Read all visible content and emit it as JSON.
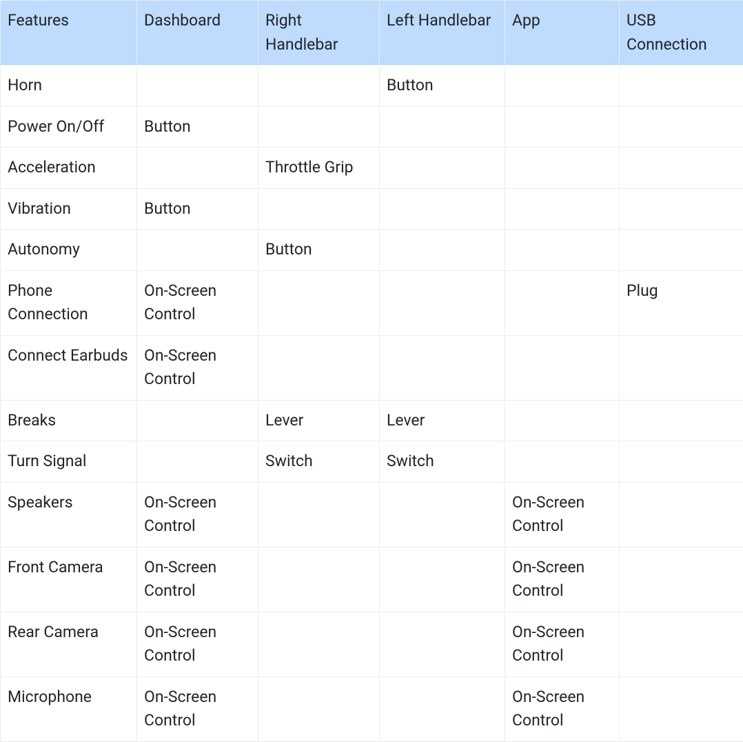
{
  "table": {
    "headers": [
      "Features",
      "Dashboard",
      "Right Handlebar",
      "Left Handlebar",
      "App",
      "USB Connection"
    ],
    "rows": [
      {
        "feature": "Horn",
        "dashboard": "",
        "right": "",
        "left": "Button",
        "app": "",
        "usb": ""
      },
      {
        "feature": "Power On/Off",
        "dashboard": "Button",
        "right": "",
        "left": "",
        "app": "",
        "usb": ""
      },
      {
        "feature": "Acceleration",
        "dashboard": "",
        "right": "Throttle Grip",
        "left": "",
        "app": "",
        "usb": ""
      },
      {
        "feature": "Vibration",
        "dashboard": "Button",
        "right": "",
        "left": "",
        "app": "",
        "usb": ""
      },
      {
        "feature": "Autonomy",
        "dashboard": "",
        "right": "Button",
        "left": "",
        "app": "",
        "usb": ""
      },
      {
        "feature": "Phone Connection",
        "dashboard": "On-Screen Control",
        "right": "",
        "left": "",
        "app": "",
        "usb": "Plug"
      },
      {
        "feature": "Connect Earbuds",
        "dashboard": "On-Screen Control",
        "right": "",
        "left": "",
        "app": "",
        "usb": ""
      },
      {
        "feature": "Breaks",
        "dashboard": "",
        "right": "Lever",
        "left": "Lever",
        "app": "",
        "usb": ""
      },
      {
        "feature": "Turn Signal",
        "dashboard": "",
        "right": "Switch",
        "left": "Switch",
        "app": "",
        "usb": ""
      },
      {
        "feature": "Speakers",
        "dashboard": "On-Screen Control",
        "right": "",
        "left": "",
        "app": "On-Screen Control",
        "usb": ""
      },
      {
        "feature": "Front Camera",
        "dashboard": "On-Screen Control",
        "right": "",
        "left": "",
        "app": "On-Screen Control",
        "usb": ""
      },
      {
        "feature": "Rear Camera",
        "dashboard": "On-Screen Control",
        "right": "",
        "left": "",
        "app": "On-Screen Control",
        "usb": ""
      },
      {
        "feature": "Microphone",
        "dashboard": "On-Screen Control",
        "right": "",
        "left": "",
        "app": "On-Screen Control",
        "usb": ""
      }
    ]
  }
}
